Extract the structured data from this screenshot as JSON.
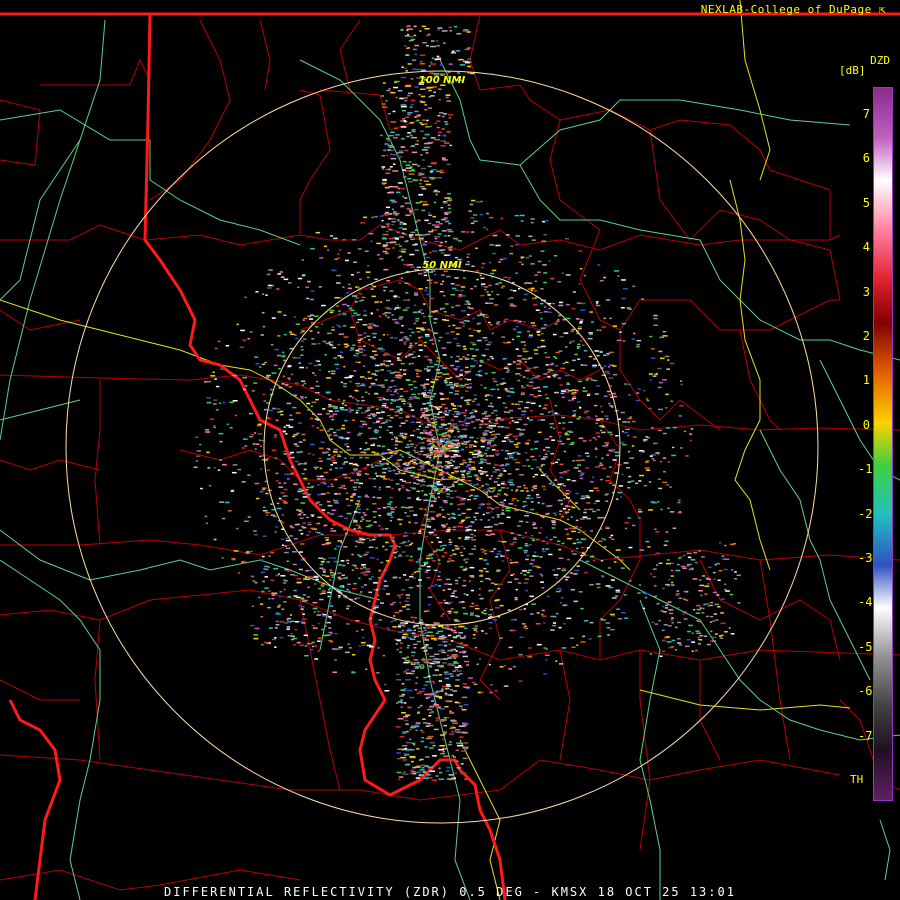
{
  "header": {
    "credit": "NEXLAB-College of DuPage"
  },
  "footer": {
    "product_caption": "DIFFERENTIAL REFLECTIVITY (ZDR) 0.5 DEG - KMSX 18 OCT 25 13:01"
  },
  "map": {
    "ring_labels": [
      "50 NMI",
      "100 NMI"
    ],
    "colors": {
      "background": "#000000",
      "state_border": "#ff1a1a",
      "county_border": "#b80000",
      "highway_green": "#5fd08a",
      "highway_yellow": "#e8e020",
      "range_ring": "#ffe0a0",
      "ring_label": "#ffff00"
    }
  },
  "legend": {
    "product_code": "DZD",
    "unit": "[dB]",
    "ticks": [
      "7",
      "6",
      "5",
      "4",
      "3",
      "2",
      "1",
      "0",
      "-1",
      "-2",
      "-3",
      "-4",
      "-5",
      "-6",
      "-7"
    ],
    "no_threshold_label": "TH",
    "gradient_colors": [
      "#8a2a8a",
      "#c060c0",
      "#ffffff",
      "#ff80a0",
      "#e02030",
      "#800000",
      "#e06000",
      "#ffd000",
      "#40d040",
      "#20c0c0",
      "#3050c0",
      "#ffffff",
      "#909090",
      "#404040",
      "#201020",
      "#602060"
    ]
  }
}
